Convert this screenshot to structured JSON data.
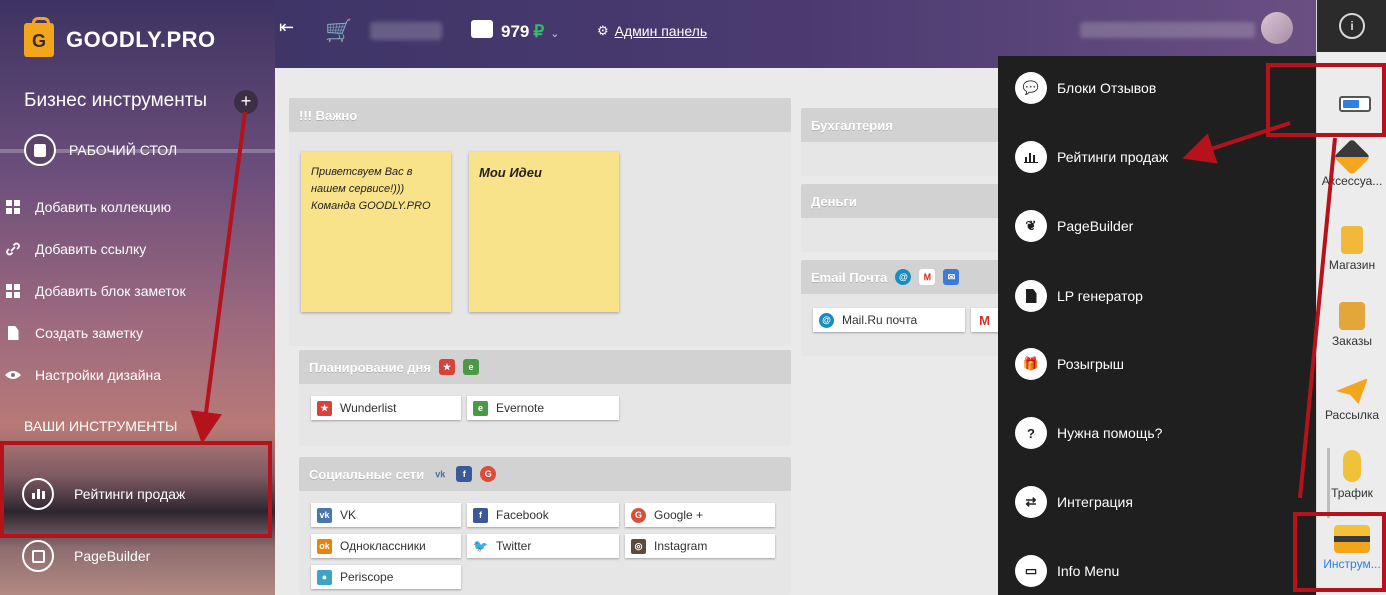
{
  "brand": {
    "logo_letter": "G",
    "name": "GOODLY.PRO"
  },
  "sidebar": {
    "title": "Бизнес инструменты",
    "plus": "+",
    "desktop": "РАБОЧИЙ СТОЛ",
    "items": [
      {
        "label": "Добавить коллекцию",
        "icon": "grid-icon"
      },
      {
        "label": "Добавить ссылку",
        "icon": "link-icon"
      },
      {
        "label": "Добавить блок заметок",
        "icon": "grid-icon"
      },
      {
        "label": "Создать заметку",
        "icon": "document-icon"
      },
      {
        "label": "Настройки дизайна",
        "icon": "eye-icon"
      }
    ],
    "tools_heading": "ВАШИ ИНСТРУМЕНТЫ",
    "tools": [
      {
        "label": "Рейтинги продаж",
        "icon": "bar-chart-icon"
      },
      {
        "label": "PageBuilder",
        "icon": "layout-icon"
      }
    ]
  },
  "header": {
    "balance": "979",
    "currency": "₽",
    "admin_label": "Админ панель"
  },
  "main": {
    "important": {
      "title": "!!! Важно",
      "notes": [
        {
          "text": "Приветсвуем Вас в нашем сервисе!))) Команда GOODLY.PRO"
        },
        {
          "text": "Мои Идеи"
        }
      ]
    },
    "planning": {
      "title": "Планирование дня",
      "chips": [
        "Wunderlist",
        "Evernote"
      ]
    },
    "social": {
      "title": "Социальные сети",
      "chips": [
        "VK",
        "Facebook",
        "Google +",
        "Одноклассники",
        "Twitter",
        "Instagram",
        "Periscope"
      ]
    },
    "accounting": {
      "title": "Бухгалтерия"
    },
    "money": {
      "title": "Деньги"
    },
    "email": {
      "title": "Email Почта",
      "chips": [
        "Mail.Ru почта"
      ]
    }
  },
  "dropdown": {
    "items": [
      {
        "label": "Блоки Отзывов",
        "icon": "chat-icon"
      },
      {
        "label": "Рейтинги продаж",
        "icon": "bar-chart-icon"
      },
      {
        "label": "PageBuilder",
        "icon": "leaf-icon"
      },
      {
        "label": "LP генератор",
        "icon": "document-icon"
      },
      {
        "label": "Розыгрыш",
        "icon": "gift-icon"
      },
      {
        "label": "Нужна помощь?",
        "icon": "question-icon"
      },
      {
        "label": "Интеграция",
        "icon": "swap-icon"
      },
      {
        "label": "Info Menu",
        "icon": "window-icon"
      }
    ]
  },
  "rightbar": {
    "info": "i",
    "items": [
      {
        "label": "Аксессуа...",
        "icon": "accessories-icon"
      },
      {
        "label": "Магазин",
        "icon": "shopping-bag-icon"
      },
      {
        "label": "Заказы",
        "icon": "box-icon"
      },
      {
        "label": "Рассылка",
        "icon": "paper-plane-icon"
      },
      {
        "label": "Трафик",
        "icon": "mouse-icon"
      },
      {
        "label": "Инструм...",
        "icon": "toolbox-icon"
      }
    ]
  },
  "colors": {
    "accent": "#f3a51c",
    "annotation": "#b5121b",
    "dropdown_bg": "#1f1f1f",
    "active_link": "#2f7fe0"
  }
}
